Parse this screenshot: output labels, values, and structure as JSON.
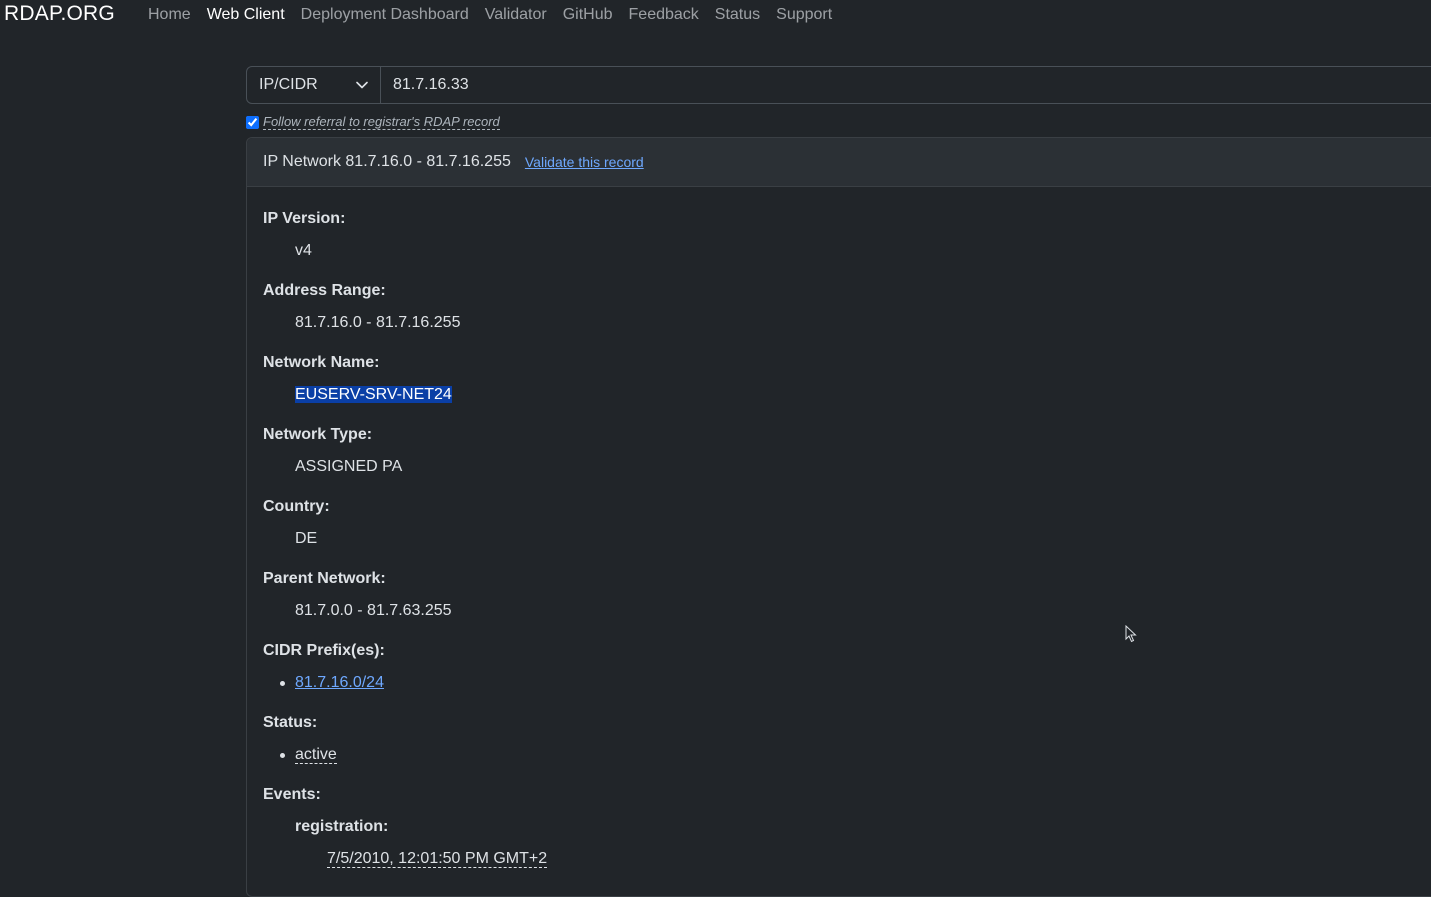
{
  "nav": {
    "brand": "RDAP.ORG",
    "links": [
      {
        "label": "Home"
      },
      {
        "label": "Web Client",
        "active": true
      },
      {
        "label": "Deployment Dashboard"
      },
      {
        "label": "Validator"
      },
      {
        "label": "GitHub"
      },
      {
        "label": "Feedback"
      },
      {
        "label": "Status"
      },
      {
        "label": "Support"
      }
    ]
  },
  "search": {
    "type_value": "IP/CIDR",
    "query_value": "81.7.16.33",
    "follow_referral_checked": true,
    "follow_referral_label": "Follow referral to registrar's RDAP record"
  },
  "result": {
    "header_title": "IP Network 81.7.16.0 - 81.7.16.255",
    "validate_link": "Validate this record",
    "fields": {
      "ip_version_label": "IP Version:",
      "ip_version_value": "v4",
      "address_range_label": "Address Range:",
      "address_range_value": "81.7.16.0 - 81.7.16.255",
      "network_name_label": "Network Name:",
      "network_name_value": "EUSERV-SRV-NET24",
      "network_type_label": "Network Type:",
      "network_type_value": "ASSIGNED PA",
      "country_label": "Country:",
      "country_value": "DE",
      "parent_network_label": "Parent Network:",
      "parent_network_value": "81.7.0.0 - 81.7.63.255",
      "cidr_label": "CIDR Prefix(es):",
      "cidr_values": [
        "81.7.16.0/24"
      ],
      "status_label": "Status:",
      "status_values": [
        "active"
      ],
      "events_label": "Events:",
      "registration_label": "registration:",
      "registration_value": "7/5/2010, 12:01:50 PM GMT+2"
    }
  },
  "colors": {
    "background": "#212529",
    "link": "#6ea8fe",
    "selection": "#0a3fa6"
  }
}
